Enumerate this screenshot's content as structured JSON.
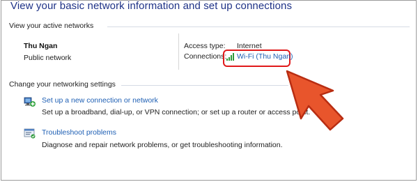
{
  "title": "View your basic network information and set up connections",
  "active_networks": {
    "header": "View your active networks",
    "network_name": "Thu Ngan",
    "network_category": "Public network",
    "access_type_label": "Access type:",
    "access_type_value": "Internet",
    "connections_label": "Connections:",
    "connection_link": "Wi-Fi (Thu Ngan)",
    "connection_icon": "wifi-signal-icon"
  },
  "change_settings": {
    "header": "Change your networking settings",
    "tasks": [
      {
        "link": "Set up a new connection or network",
        "description": "Set up a broadband, dial-up, or VPN connection; or set up a router or access point.",
        "icon": "new-connection-icon"
      },
      {
        "link": "Troubleshoot problems",
        "description": "Diagnose and repair network problems, or get troubleshooting information.",
        "icon": "troubleshoot-icon"
      }
    ]
  },
  "colors": {
    "title": "#1e3287",
    "link": "#1e5fb4",
    "highlight": "#e0191a",
    "arrow_fill": "#e8552c"
  }
}
